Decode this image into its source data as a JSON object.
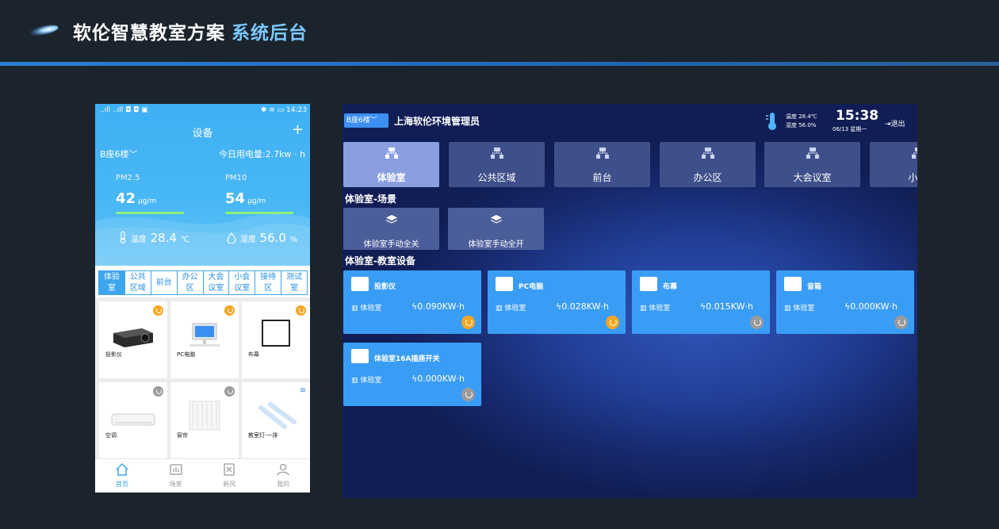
{
  "header": {
    "title": "软伦智慧教室方案",
    "subtitle": "系统后台"
  },
  "phone": {
    "status_left": "..ıll ..ıll ◘ ◘ ▣",
    "status_right": "✱ ≋ ▭ 14:23",
    "title": "设备",
    "plus": "+",
    "floor": "B座6楼﹀",
    "power_today": "今日用电量:2.7kw · h",
    "pm25": {
      "label": "PM2.5",
      "value": "42",
      "unit": "μg/m"
    },
    "pm10": {
      "label": "PM10",
      "value": "54",
      "unit": "μg/m"
    },
    "temp_label": "温度",
    "temp_value": "28.4",
    "temp_unit": "℃",
    "humid_label": "湿度",
    "humid_value": "56.0",
    "humid_unit": "%",
    "tabs": [
      {
        "l1": "体验",
        "l2": "室"
      },
      {
        "l1": "公共",
        "l2": "区域"
      },
      {
        "l1": "前台",
        "l2": ""
      },
      {
        "l1": "办公",
        "l2": "区"
      },
      {
        "l1": "大会",
        "l2": "议室"
      },
      {
        "l1": "小会",
        "l2": "议室"
      },
      {
        "l1": "接待",
        "l2": "区"
      },
      {
        "l1": "测试",
        "l2": "室"
      }
    ],
    "devices": [
      {
        "name": "投影仪"
      },
      {
        "name": "PC电脑"
      },
      {
        "name": "布幕"
      },
      {
        "name": "空调"
      },
      {
        "name": "窗帘"
      },
      {
        "name": "教室灯-一排"
      }
    ],
    "nav": [
      {
        "label": "首页"
      },
      {
        "label": "场景"
      },
      {
        "label": "新风"
      },
      {
        "label": "我的"
      }
    ],
    "colors": {
      "primary": "#3ea6ef",
      "power_on": "#f5a623",
      "power_off": "#9a9a9a"
    }
  },
  "dashboard": {
    "floor": "B座6楼﹀",
    "user": "上海软伦环境管理员",
    "temp": "温度 28.4℃",
    "humid": "湿度 56.0%",
    "time": "15:38",
    "date": "06/13 星期一",
    "logout": "退出",
    "areas": [
      "体验室",
      "公共区域",
      "前台",
      "办公区",
      "大会议室",
      "小会"
    ],
    "scene_title": "体验室-场景",
    "scenes": [
      "体验室手动全关",
      "体验室手动全开"
    ],
    "device_title": "体验室-教室设备",
    "devices": [
      {
        "name": "投影仪",
        "room": "体验室",
        "kwh": "0.090KW·h",
        "on": true
      },
      {
        "name": "PC电脑",
        "room": "体验室",
        "kwh": "0.028KW·h",
        "on": true
      },
      {
        "name": "布幕",
        "room": "体验室",
        "kwh": "0.015KW·h",
        "on": false
      },
      {
        "name": "音箱",
        "room": "体验室",
        "kwh": "0.000KW·h",
        "on": false
      },
      {
        "name": "体验室16A插座开关",
        "room": "体验室",
        "kwh": "0.000KW·h",
        "on": false
      }
    ],
    "colors": {
      "card": "#3a9df5",
      "tab": "#3f4f8a",
      "tab_active": "#8a9ee0"
    }
  }
}
